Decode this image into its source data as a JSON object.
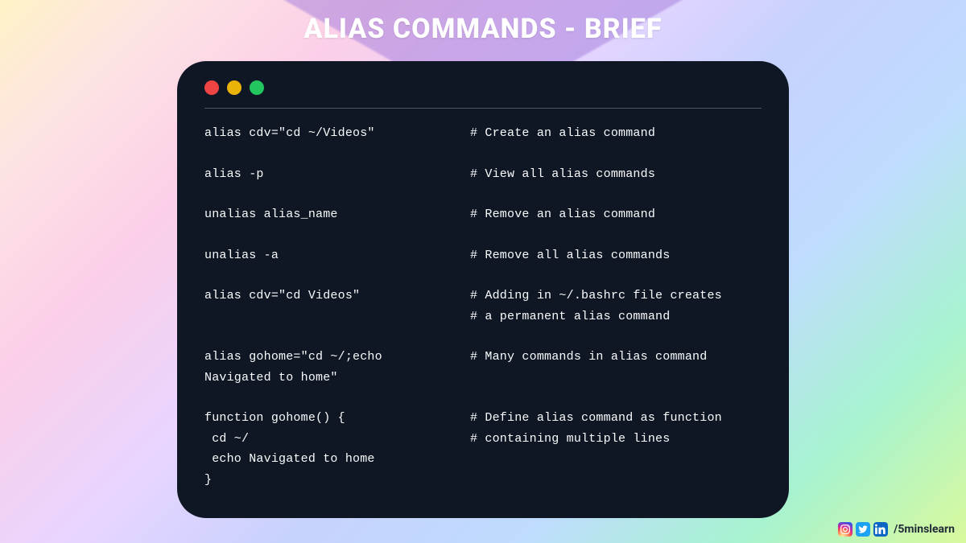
{
  "title": "ALIAS COMMANDS - BRIEF",
  "blocks": [
    {
      "cmd": [
        "alias cdv=\"cd ~/Videos\""
      ],
      "cmt": [
        "# Create an alias command"
      ]
    },
    {
      "cmd": [
        "alias -p"
      ],
      "cmt": [
        "# View all alias commands"
      ]
    },
    {
      "cmd": [
        "unalias alias_name"
      ],
      "cmt": [
        "# Remove an alias command"
      ]
    },
    {
      "cmd": [
        "unalias -a"
      ],
      "cmt": [
        "# Remove all alias commands"
      ]
    },
    {
      "cmd": [
        "alias cdv=\"cd Videos\"",
        ""
      ],
      "cmt": [
        "# Adding in ~/.bashrc file creates",
        "# a permanent alias command"
      ]
    },
    {
      "cmd": [
        "alias gohome=\"cd ~/;echo",
        "Navigated to home\""
      ],
      "cmt": [
        "# Many commands in alias command",
        ""
      ]
    },
    {
      "cmd": [
        "function gohome() {",
        " cd ~/",
        " echo Navigated to home",
        "}"
      ],
      "cmt": [
        "# Define alias command as function",
        "# containing multiple lines",
        "",
        ""
      ]
    }
  ],
  "social": {
    "instagram": "instagram-icon",
    "twitter": "twitter-icon",
    "linkedin": "linkedin-icon",
    "handle": "/5minslearn"
  }
}
